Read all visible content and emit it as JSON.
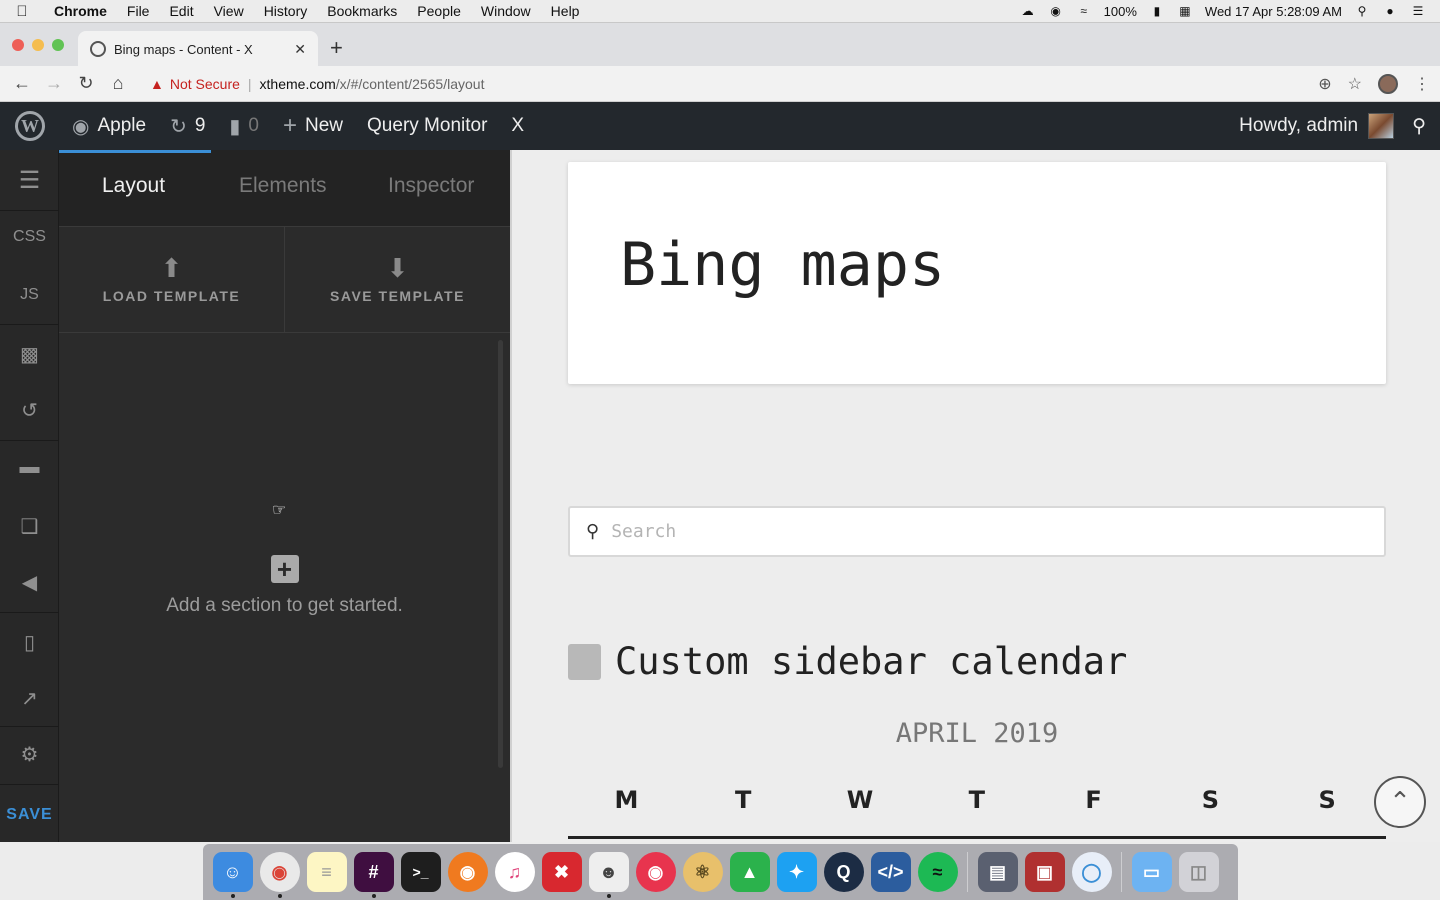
{
  "menubar": {
    "app": "Chrome",
    "items": [
      "File",
      "Edit",
      "View",
      "History",
      "Bookmarks",
      "People",
      "Window",
      "Help"
    ],
    "battery": "100%",
    "clock": "Wed 17 Apr  5:28:09 AM"
  },
  "browser": {
    "tab_title": "Bing maps - Content - X",
    "security_label": "Not Secure",
    "url_host": "xtheme.com",
    "url_path": "/x/#/content/2565/layout"
  },
  "wpbar": {
    "site_name": "Apple",
    "updates_count": "9",
    "comments_count": "0",
    "new_label": "New",
    "query_monitor_label": "Query Monitor",
    "x_label": "X",
    "howdy": "Howdy, admin"
  },
  "rail": {
    "css_label": "CSS",
    "js_label": "JS",
    "save_label": "SAVE"
  },
  "panel": {
    "tabs": [
      "Layout",
      "Elements",
      "Inspector"
    ],
    "active_tab": "Layout",
    "load_template": "LOAD TEMPLATE",
    "save_template": "SAVE TEMPLATE",
    "empty_message": "Add a section to get started."
  },
  "preview": {
    "page_title": "Bing maps",
    "search_placeholder": "Search",
    "calendar_heading": "Custom sidebar calendar",
    "calendar_month": "APRIL 2019",
    "weekdays": [
      "M",
      "T",
      "W",
      "T",
      "F",
      "S",
      "S"
    ]
  },
  "colors": {
    "accent": "#3b8fd6",
    "wp_bar": "#23282d",
    "panel_bg": "#2b2b2b",
    "danger": "#c5221f"
  },
  "dock": {
    "apps": [
      "finder-icon",
      "chrome-icon",
      "notes-icon",
      "slack-icon",
      "terminal-icon",
      "firefox-icon",
      "itunes-icon",
      "crossover-icon",
      "tableplus-icon",
      "lips-icon",
      "atom-icon",
      "feedly-icon",
      "twitter-icon",
      "quicktime-icon",
      "vscode-icon",
      "spotify-icon",
      "network-icon",
      "photobooth-icon",
      "safari-icon",
      "downloads-folder-icon",
      "trash-icon"
    ]
  }
}
